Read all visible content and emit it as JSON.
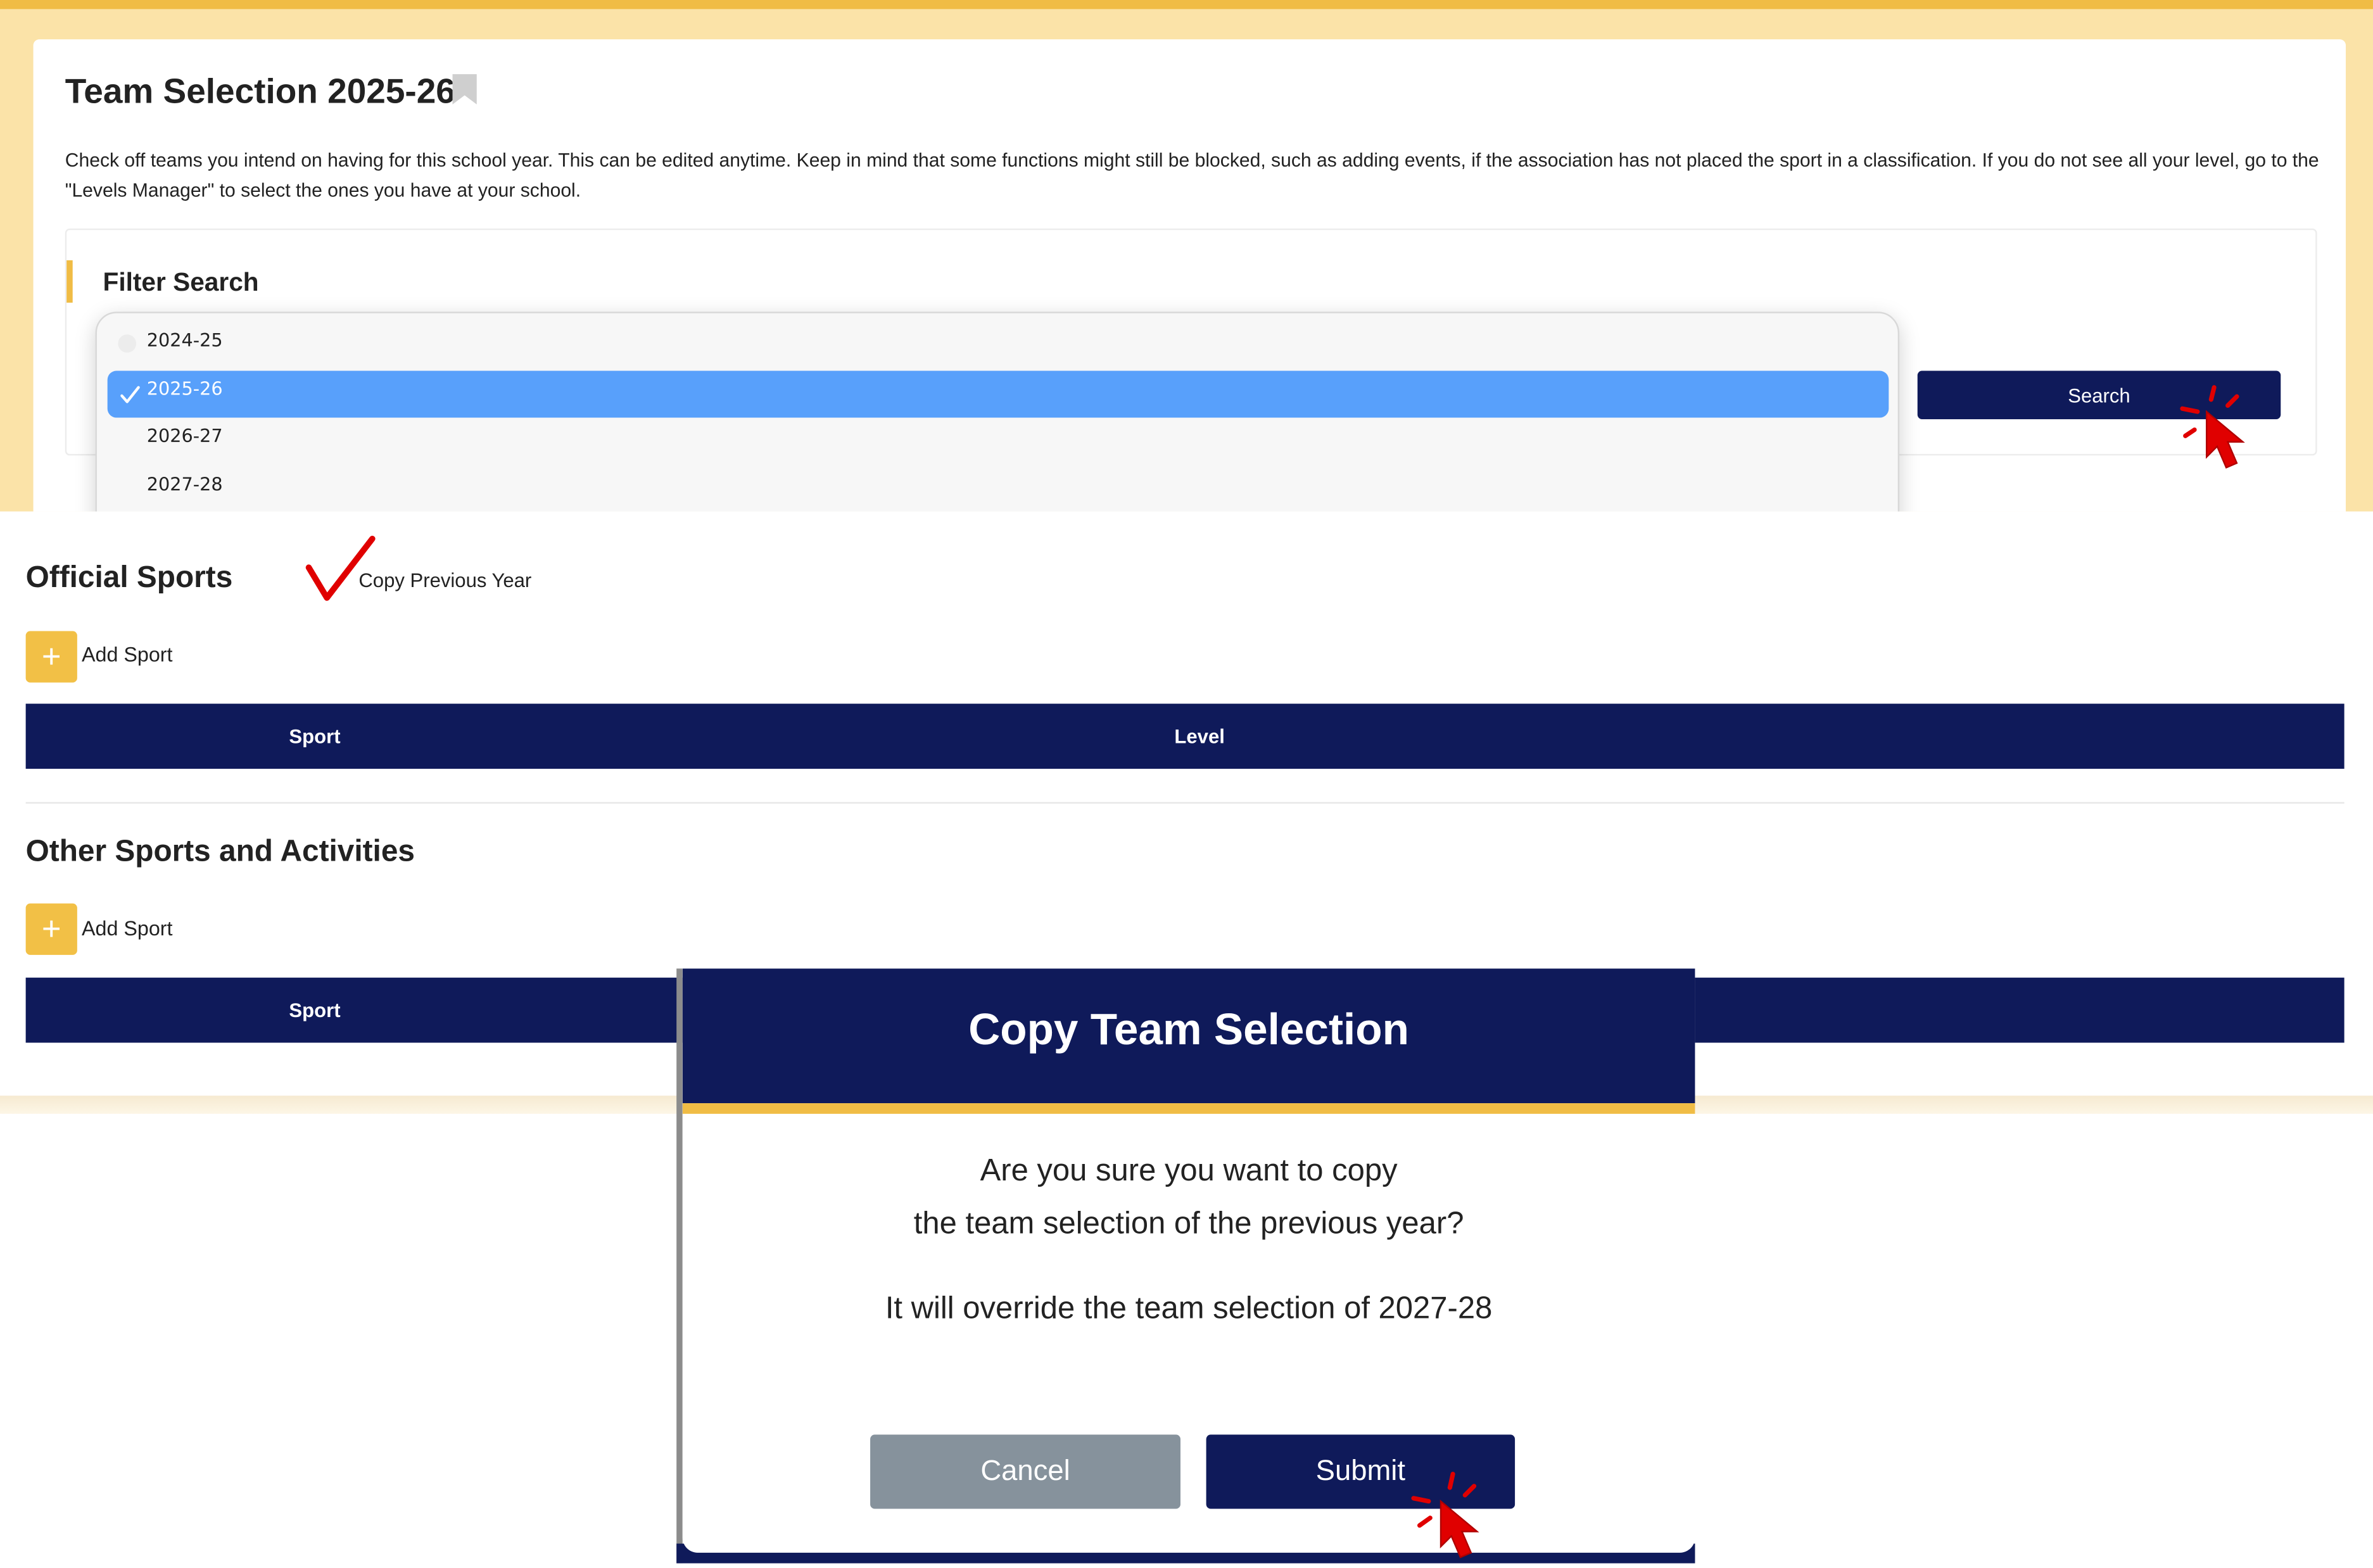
{
  "header": {
    "page_title": "Team Selection 2025-26",
    "intro": "Check off teams you intend on having for this school year. This can be edited anytime. Keep in mind that some functions might still be blocked, such as adding events, if the association has not placed the sport in a classification. If you do not see all your level, go to the \"Levels Manager\" to select the ones you have at your school."
  },
  "filter": {
    "title": "Filter Search",
    "year_options": [
      "2024-25",
      "2025-26",
      "2026-27",
      "2027-28"
    ],
    "selected_year": "2025-26",
    "search_label": "Search"
  },
  "official": {
    "title": "Official Sports",
    "copy_previous_label": "Copy Previous Year",
    "add_label": "Add Sport",
    "add_symbol": "+",
    "columns": [
      "Sport",
      "Level"
    ]
  },
  "other": {
    "title": "Other Sports and Activities",
    "add_label": "Add Sport",
    "add_symbol": "+",
    "columns": [
      "Sport"
    ]
  },
  "modal": {
    "title": "Copy Team Selection",
    "line1": "Are you sure you want to copy",
    "line2": "the team selection of the previous year?",
    "line3": "It will override the team selection of 2027-28",
    "cancel_label": "Cancel",
    "submit_label": "Submit"
  },
  "colors": {
    "navy": "#0f1a5a",
    "accent_yellow": "#f0bc45",
    "selected_blue": "#58a0fb",
    "cancel_gray": "#86929c",
    "annotation_red": "#e00000"
  }
}
